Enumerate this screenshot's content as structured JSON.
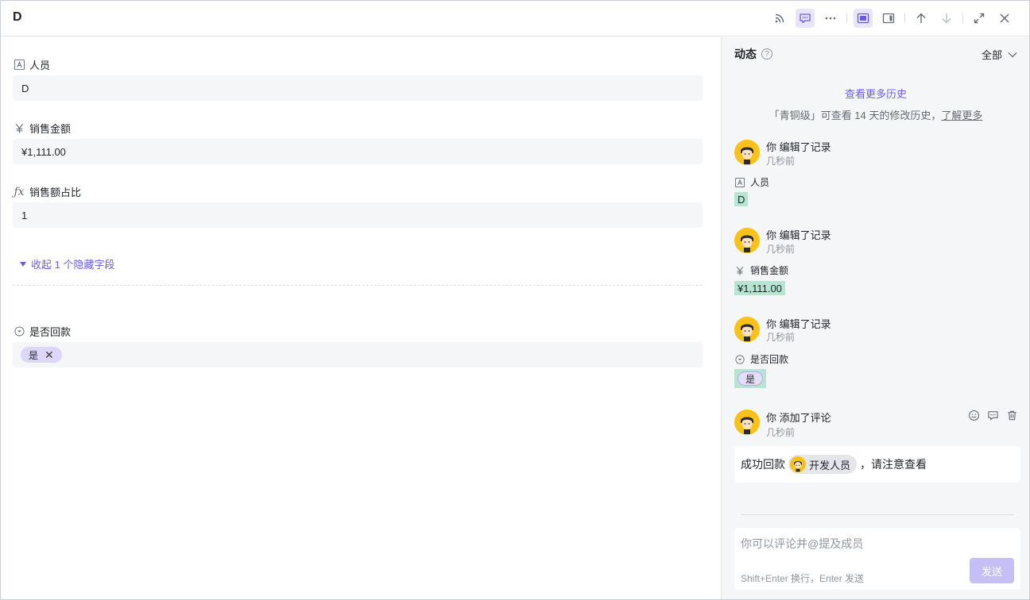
{
  "record": {
    "title": "D"
  },
  "colors": {
    "accent": "#6b5ce7",
    "highlight": "#b7e5d1",
    "chip": "#ddd6f8",
    "avatar": "#f8c21b"
  },
  "header": {
    "icons": [
      "rss-icon",
      "comment-icon",
      "more-icon",
      "modal-view-icon",
      "side-view-icon",
      "arrow-up-icon",
      "arrow-down-icon",
      "expand-icon",
      "close-icon"
    ]
  },
  "fields": [
    {
      "icon": "text-field-icon",
      "label": "人员",
      "value": "D"
    },
    {
      "icon": "currency-field-icon",
      "label": "销售金额",
      "value": "¥1,111.00"
    },
    {
      "icon": "formula-field-icon",
      "label": "销售额占比",
      "value": "1"
    }
  ],
  "collapse_hidden": "收起 1 个隐藏字段",
  "hidden_field": {
    "icon": "single-select-icon",
    "label": "是否回款",
    "value": "是"
  },
  "panel": {
    "title": "动态",
    "filter": "全部",
    "more_history": "查看更多历史",
    "history_note": "「青铜级」可查看 14 天的修改历史，",
    "learn_more": "了解更多",
    "activities": [
      {
        "title": "你 编辑了记录",
        "time": "几秒前",
        "field": "人员",
        "value": "D"
      },
      {
        "title": "你 编辑了记录",
        "time": "几秒前",
        "field": "销售金额",
        "value": "¥1,111.00"
      },
      {
        "title": "你 编辑了记录",
        "time": "几秒前",
        "field": "是否回款",
        "value": "是"
      },
      {
        "title": "你 添加了评论",
        "time": "几秒前"
      }
    ],
    "comment": {
      "before": "成功回款",
      "mention": "开发人员",
      "after": "，请注意查看"
    },
    "input_placeholder": "你可以评论并@提及成员",
    "input_hint": "Shift+Enter 换行，Enter 发送",
    "send_label": "发送"
  }
}
